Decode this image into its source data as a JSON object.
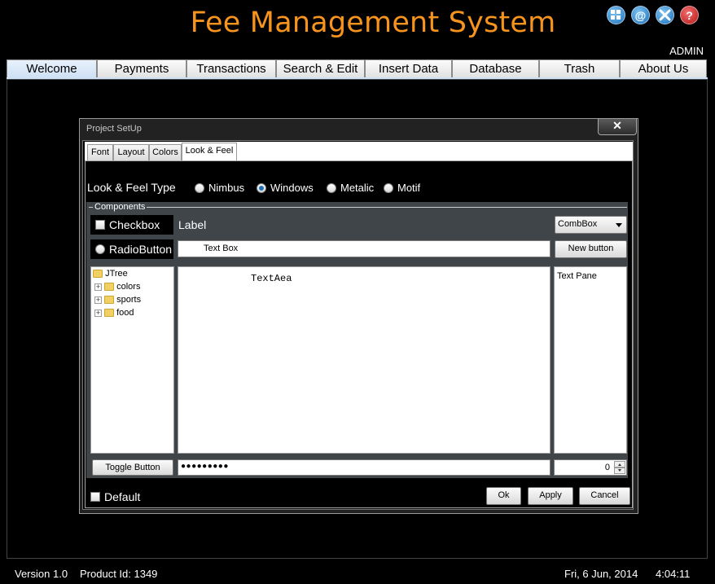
{
  "app": {
    "title": "Fee Management System",
    "user": "ADMIN",
    "header_icons": [
      "grid-icon",
      "at-sign-icon",
      "tools-icon",
      "help-icon"
    ],
    "accent_color": "#f7941d"
  },
  "tabs": [
    {
      "label": "Welcome",
      "selected": true
    },
    {
      "label": "Payments",
      "selected": false
    },
    {
      "label": "Transactions",
      "selected": false
    },
    {
      "label": "Search & Edit",
      "selected": false
    },
    {
      "label": "Insert Data",
      "selected": false
    },
    {
      "label": "Database",
      "selected": false
    },
    {
      "label": "Trash",
      "selected": false
    },
    {
      "label": "About Us",
      "selected": false
    }
  ],
  "dialog": {
    "title": "Project SetUp",
    "close_label": "✕",
    "tabs": [
      "Font",
      "Layout",
      "Colors",
      "Look & Feel"
    ],
    "selected_tab": "Look & Feel",
    "laf_label": "Look & Feel Type",
    "laf_options": [
      {
        "label": "Nimbus",
        "selected": false
      },
      {
        "label": "Windows",
        "selected": true
      },
      {
        "label": "Metalic",
        "selected": false
      },
      {
        "label": "Motif",
        "selected": false
      }
    ],
    "components_label": "Components",
    "checkbox_label": "Checkbox",
    "label_text": "Label",
    "combobox_value": "CombBox",
    "radio_label": "RadioButton",
    "textbox_value": "Text Box",
    "new_button_label": "New button",
    "tree": {
      "root": "JTree",
      "children": [
        "colors",
        "sports",
        "food"
      ]
    },
    "textarea_value": "TextAea",
    "textpane_value": "Text Pane",
    "toggle_label": "Toggle Button",
    "password_value": "●●●●●●●●●",
    "spinner_value": "0",
    "default_label": "Default",
    "ok_label": "Ok",
    "apply_label": "Apply",
    "cancel_label": "Cancel"
  },
  "footer": {
    "version": "Version 1.0",
    "product_id": "Product Id: 1349",
    "date": "Fri, 6 Jun, 2014",
    "time": "4:04:11"
  }
}
